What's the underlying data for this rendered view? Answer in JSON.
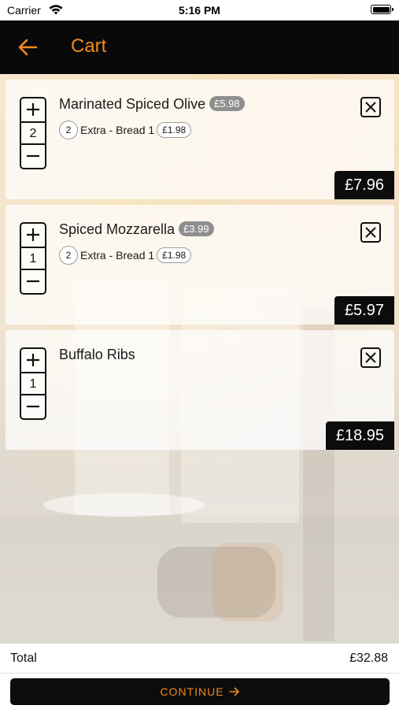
{
  "status_bar": {
    "carrier": "Carrier",
    "time": "5:16 PM"
  },
  "header": {
    "title": "Cart"
  },
  "cart": {
    "items": [
      {
        "name": "Marinated Spiced Olive",
        "unit_price": "£5.98",
        "quantity": "2",
        "extra_qty": "2",
        "extra_name": "Extra - Bread 1",
        "extra_price": "£1.98",
        "line_total": "£7.96"
      },
      {
        "name": "Spiced Mozzarella",
        "unit_price": "£3.99",
        "quantity": "1",
        "extra_qty": "2",
        "extra_name": "Extra - Bread 1",
        "extra_price": "£1.98",
        "line_total": "£5.97"
      },
      {
        "name": "Buffalo Ribs",
        "quantity": "1",
        "line_total": "£18.95"
      }
    ]
  },
  "footer": {
    "total_label": "Total",
    "total_value": "£32.88",
    "continue_label": "CONTINUE"
  },
  "colors": {
    "accent": "#f28a1e",
    "nav_bg": "#090909",
    "price_badge": "#8e8e8e"
  },
  "icons": [
    "wifi-icon",
    "battery-icon",
    "back-arrow-icon",
    "plus-icon",
    "minus-icon",
    "close-icon",
    "arrow-right-icon"
  ]
}
